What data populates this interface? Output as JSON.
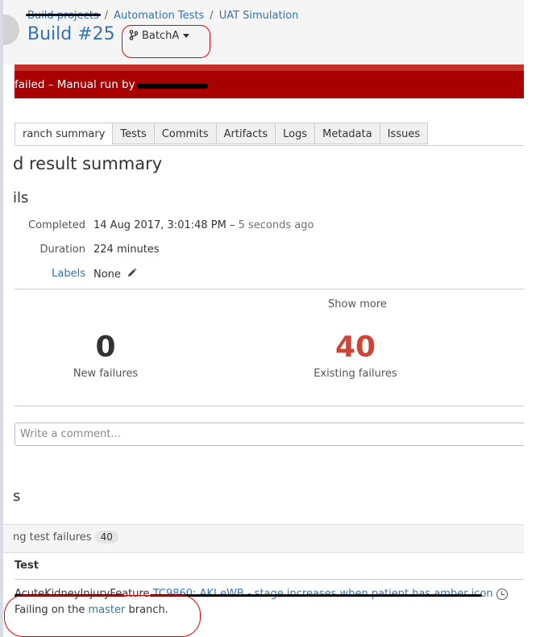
{
  "breadcrumb": [
    "Build projects",
    "Automation Tests",
    "UAT Simulation"
  ],
  "build": {
    "title": "Build #25",
    "branch": "BatchA"
  },
  "banner": {
    "text": "failed – Manual run by "
  },
  "tabs": [
    "ranch summary",
    "Tests",
    "Commits",
    "Artifacts",
    "Logs",
    "Metadata",
    "Issues"
  ],
  "summary": {
    "heading": "d result summary"
  },
  "details": {
    "heading": "ils",
    "completed_label": "Completed",
    "completed_value": "14 Aug 2017, 3:01:48 PM –",
    "completed_ago": "5 seconds ago",
    "duration_label": "Duration",
    "duration_value": "224 minutes",
    "labels_label": "Labels",
    "labels_value": "None"
  },
  "stats": {
    "show_more": "Show more",
    "new_count": "0",
    "new_label": "New failures",
    "existing_count": "40",
    "existing_label": "Existing failures"
  },
  "comment": {
    "placeholder": "Write a comment..."
  },
  "tests": {
    "heading": "s",
    "failures_label": "ng test failures",
    "failures_count": "40",
    "column_test": "Test",
    "row": {
      "class": "AcuteKidneyInjuryFeature",
      "name": "TC9860: AKI eWB - stage increases when patient has amber icon",
      "failing_prefix": "Failing on the ",
      "failing_branch": "master",
      "failing_suffix": " branch."
    }
  },
  "colors": {
    "link": "#3572b0",
    "banner": "#a80000",
    "existing": "#d04437",
    "annotation": "#e00000"
  }
}
